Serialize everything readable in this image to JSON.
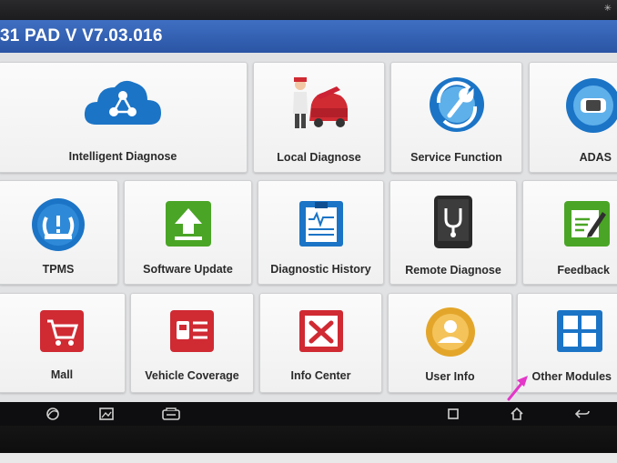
{
  "app": {
    "title": "31 PAD V V7.03.016"
  },
  "status": {
    "bluetooth_icon": "bluetooth-icon"
  },
  "tiles": [
    {
      "label": "Intelligent Diagnose",
      "icon": "cloud-network-icon"
    },
    {
      "label": "Local Diagnose",
      "icon": "mechanic-car-icon"
    },
    {
      "label": "Service Function",
      "icon": "wrench-circle-icon"
    },
    {
      "label": "ADAS",
      "icon": "car-sensor-icon"
    },
    {
      "label": "TPMS",
      "icon": "tire-pressure-icon"
    },
    {
      "label": "Software Update",
      "icon": "upload-arrow-icon"
    },
    {
      "label": "Diagnostic History",
      "icon": "clipboard-chart-icon"
    },
    {
      "label": "Remote Diagnose",
      "icon": "stethoscope-tablet-icon"
    },
    {
      "label": "Feedback",
      "icon": "edit-note-icon"
    },
    {
      "label": "Mall",
      "icon": "shopping-cart-icon"
    },
    {
      "label": "Vehicle Coverage",
      "icon": "vehicle-list-icon"
    },
    {
      "label": "Info Center",
      "icon": "tools-book-icon"
    },
    {
      "label": "User Info",
      "icon": "user-avatar-icon"
    },
    {
      "label": "Other Modules",
      "icon": "grid-modules-icon"
    }
  ],
  "navbar": {
    "buttons": [
      "browser-icon",
      "gallery-icon",
      "vci-icon",
      "recent-apps-icon",
      "home-icon",
      "back-icon"
    ]
  },
  "colors": {
    "titlebar": "#2b55a5",
    "blue_icon": "#1b74c6",
    "green_icon": "#4aa526",
    "red_icon": "#d02a33",
    "gold_icon": "#e3a62b",
    "arrow": "#e436c8"
  }
}
